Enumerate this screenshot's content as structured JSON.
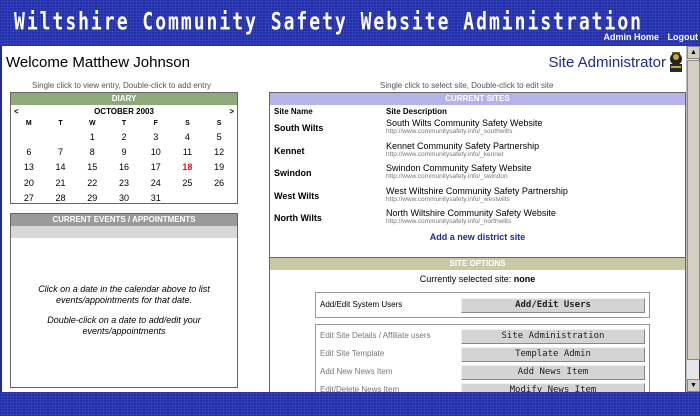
{
  "header": {
    "title": "Wiltshire Community Safety Website Administration",
    "links": [
      "Admin Home",
      "Logout"
    ]
  },
  "welcome": "Welcome Matthew Johnson",
  "role": "Site Administrator",
  "hints": {
    "calendar": "Single click to view entry, Double-click to add entry",
    "sites": "Single click to select site, Double-click to edit site"
  },
  "diary": {
    "title": "DIARY",
    "month": "OCTOBER 2003",
    "prev": "<",
    "next": ">",
    "weekdays": [
      "M",
      "T",
      "W",
      "T",
      "F",
      "S",
      "S"
    ],
    "weeks": [
      [
        "",
        "",
        "1",
        "2",
        "3",
        "4",
        "5"
      ],
      [
        "6",
        "7",
        "8",
        "9",
        "10",
        "11",
        "12"
      ],
      [
        "13",
        "14",
        "15",
        "16",
        "17",
        "18",
        "19"
      ],
      [
        "20",
        "21",
        "22",
        "23",
        "24",
        "25",
        "26"
      ],
      [
        "27",
        "28",
        "29",
        "30",
        "31",
        "",
        ""
      ]
    ],
    "highlight": "18"
  },
  "events": {
    "title": "CURRENT EVENTS / APPOINTMENTS",
    "msg1": "Click on a date in the calendar above to list events/appointments for that date.",
    "msg2": "Double-click on a date to add/edit your events/appointments"
  },
  "sites": {
    "title": "CURRENT SITES",
    "col_name": "Site Name",
    "col_desc": "Site Description",
    "rows": [
      {
        "name": "South Wilts",
        "desc": "South Wilts Community Safety Website",
        "url": "http://www.communitysafety.info/_southwilts"
      },
      {
        "name": "Kennet",
        "desc": "Kennet Community Safety Partnership",
        "url": "http://www.communitysafety.info/_kennet"
      },
      {
        "name": "Swindon",
        "desc": "Swindon Community Safety Website",
        "url": "http://www.communitysafety.info/_swindon"
      },
      {
        "name": "West Wilts",
        "desc": "West Wiltshire Community Safety Partnership",
        "url": "http://www.communitysafety.info/_westwilts"
      },
      {
        "name": "North Wilts",
        "desc": "North Wiltshire Community Safety Website",
        "url": "http://www.communitysafety.info/_northwilts"
      }
    ],
    "add_link": "Add a new district site"
  },
  "options": {
    "title": "SITE OPTIONS",
    "selected_label": "Currently selected site:",
    "selected_value": "none",
    "system_label": "Add/Edit System Users",
    "system_button": "Add/Edit Users",
    "items": [
      {
        "label": "Edit Site Details / Affiliate users",
        "button": "Site Administration"
      },
      {
        "label": "Edit Site Template",
        "button": "Template Admin"
      },
      {
        "label": "Add New News Item",
        "button": "Add News Item"
      },
      {
        "label": "Edit/Delete News Item",
        "button": "Modify News Item"
      }
    ]
  },
  "scrollbar": {
    "up": "▲",
    "down": "▼"
  }
}
